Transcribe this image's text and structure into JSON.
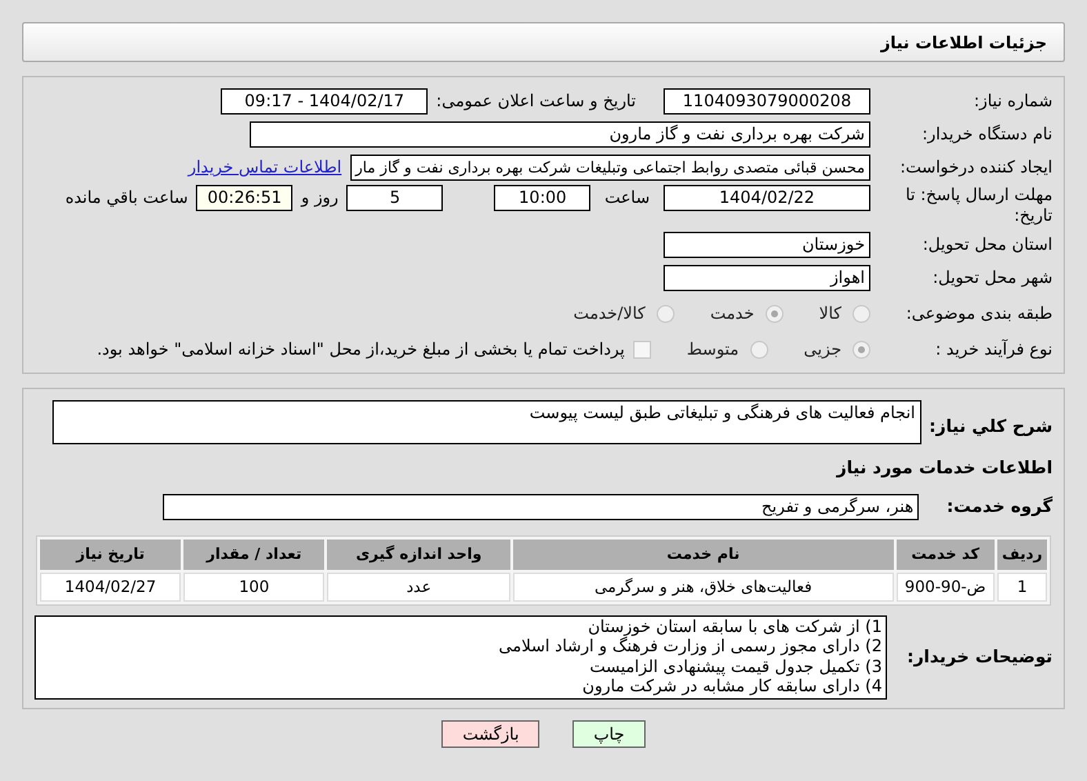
{
  "header": {
    "title": "جزئیات اطلاعات نیاز"
  },
  "details": {
    "need_number": {
      "label": "شماره نیاز:",
      "value": "1104093079000208"
    },
    "announce": {
      "label": "تاریخ و ساعت اعلان عمومی:",
      "value": "1404/02/17 - 09:17"
    },
    "buyer": {
      "label": "نام دستگاه خریدار:",
      "value": "شرکت بهره برداری نفت و گاز مارون"
    },
    "requester": {
      "label": "ایجاد کننده درخواست:",
      "value": "محسن قبائی متصدی روابط اجتماعی وتبلیغات شرکت بهره برداری نفت و گاز مار",
      "link": "اطلاعات تماس خریدار"
    },
    "deadline": {
      "label": "مهلت ارسال پاسخ: تا تاریخ:",
      "date": "1404/02/22",
      "time_label": "ساعت",
      "time": "10:00",
      "days": "5",
      "days_label": "روز و",
      "remaining": "00:26:51",
      "remaining_label": "ساعت باقي مانده"
    },
    "province": {
      "label": "استان محل تحویل:",
      "value": "خوزستان"
    },
    "city": {
      "label": "شهر محل تحویل:",
      "value": "اهواز"
    },
    "category": {
      "label": "طبقه بندی موضوعی:",
      "options": [
        {
          "label": "کالا",
          "selected": false
        },
        {
          "label": "خدمت",
          "selected": true
        },
        {
          "label": "کالا/خدمت",
          "selected": false
        }
      ]
    },
    "process": {
      "label": "نوع فرآیند خرید :",
      "options": [
        {
          "label": "جزیی",
          "selected": true
        },
        {
          "label": "متوسط",
          "selected": false
        }
      ],
      "payment": {
        "checked": false,
        "label": "پرداخت تمام یا بخشی از مبلغ خرید،از محل \"اسناد خزانه اسلامی\" خواهد بود."
      }
    }
  },
  "services": {
    "description": {
      "label": "شرح کلي نياز:",
      "value": "انجام فعالیت های فرهنگی و تبلیغاتی طبق لیست پیوست"
    },
    "title": "اطلاعات خدمات مورد نیاز",
    "group": {
      "label": "گروه خدمت:",
      "value": "هنر، سرگرمی و تفریح"
    },
    "table": {
      "columns": [
        "ردیف",
        "کد خدمت",
        "نام خدمت",
        "واحد اندازه گیری",
        "تعداد / مقدار",
        "تاریخ نیاز"
      ],
      "rows": [
        [
          "1",
          "ض-90-900",
          "فعالیت‌های خلاق، هنر و سرگرمی",
          "عدد",
          "100",
          "1404/02/27"
        ]
      ]
    },
    "notes": {
      "label": "توضیحات خریدار:",
      "lines": [
        "1) از شرکت های با سابقه استان خوزستان",
        "2) دارای مجوز رسمی از وزارت فرهنگ و ارشاد اسلامی",
        "3) تکمیل جدول قیمت پیشنهادی الزامیست",
        "4) دارای سابقه کار مشابه در شرکت مارون"
      ]
    }
  },
  "buttons": [
    {
      "label": "چاپ",
      "color": "#e0ffe0"
    },
    {
      "label": "بازگشت",
      "color": "#ffdcdc"
    }
  ]
}
